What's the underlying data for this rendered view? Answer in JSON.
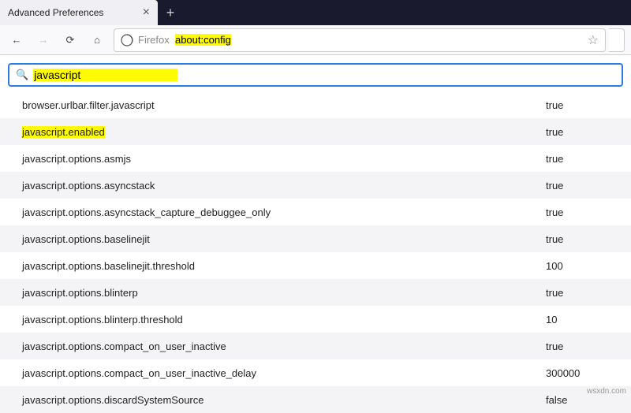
{
  "titlebar": {
    "tab_title": "Advanced Preferences",
    "close_glyph": "×",
    "newtab_glyph": "+"
  },
  "toolbar": {
    "back_glyph": "←",
    "forward_glyph": "→",
    "reload_glyph": "⟳",
    "home_glyph": "⌂",
    "url_prefix": "Firefox",
    "url_value": "about:config",
    "star_glyph": "☆"
  },
  "search": {
    "icon_glyph": "🔍",
    "value": "javascript"
  },
  "prefs": [
    {
      "name": "browser.urlbar.filter.javascript",
      "value": "true",
      "highlight": false
    },
    {
      "name": "javascript.enabled",
      "value": "true",
      "highlight": true
    },
    {
      "name": "javascript.options.asmjs",
      "value": "true",
      "highlight": false
    },
    {
      "name": "javascript.options.asyncstack",
      "value": "true",
      "highlight": false
    },
    {
      "name": "javascript.options.asyncstack_capture_debuggee_only",
      "value": "true",
      "highlight": false
    },
    {
      "name": "javascript.options.baselinejit",
      "value": "true",
      "highlight": false
    },
    {
      "name": "javascript.options.baselinejit.threshold",
      "value": "100",
      "highlight": false
    },
    {
      "name": "javascript.options.blinterp",
      "value": "true",
      "highlight": false
    },
    {
      "name": "javascript.options.blinterp.threshold",
      "value": "10",
      "highlight": false
    },
    {
      "name": "javascript.options.compact_on_user_inactive",
      "value": "true",
      "highlight": false
    },
    {
      "name": "javascript.options.compact_on_user_inactive_delay",
      "value": "300000",
      "highlight": false
    },
    {
      "name": "javascript.options.discardSystemSource",
      "value": "false",
      "highlight": false
    }
  ],
  "watermark": "wsxdn.com"
}
